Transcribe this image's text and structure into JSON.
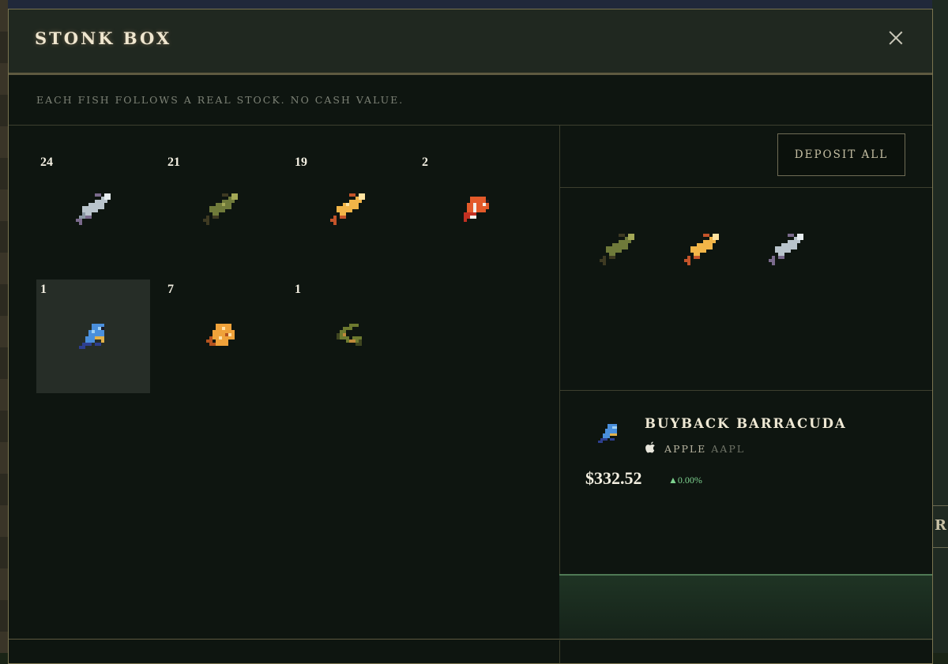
{
  "modal": {
    "title": "STONK BOX",
    "subtitle": "EACH FISH FOLLOWS A REAL STOCK. NO CASH VALUE.",
    "close_icon": "close-icon"
  },
  "inventory": [
    {
      "count": "24",
      "fish": "silver-fish-icon"
    },
    {
      "count": "21",
      "fish": "green-fish-icon"
    },
    {
      "count": "19",
      "fish": "gold-fish-icon"
    },
    {
      "count": "2",
      "fish": "clownfish-icon"
    },
    {
      "count": "1",
      "fish": "blue-barracuda-icon",
      "selected": true
    },
    {
      "count": "7",
      "fish": "orange-spotted-fish-icon"
    },
    {
      "count": "1",
      "fish": "eel-icon"
    }
  ],
  "deposit": {
    "label": "DEPOSIT ALL"
  },
  "preview_fish": [
    "green-fish-icon",
    "gold-fish-icon",
    "silver-fish-icon"
  ],
  "selected_fish": {
    "name": "BUYBACK BARRACUDA",
    "company": "APPLE",
    "ticker": "AAPL",
    "price": "$332.52",
    "change": "▲0.00%",
    "change_color": "#7dd28f"
  }
}
